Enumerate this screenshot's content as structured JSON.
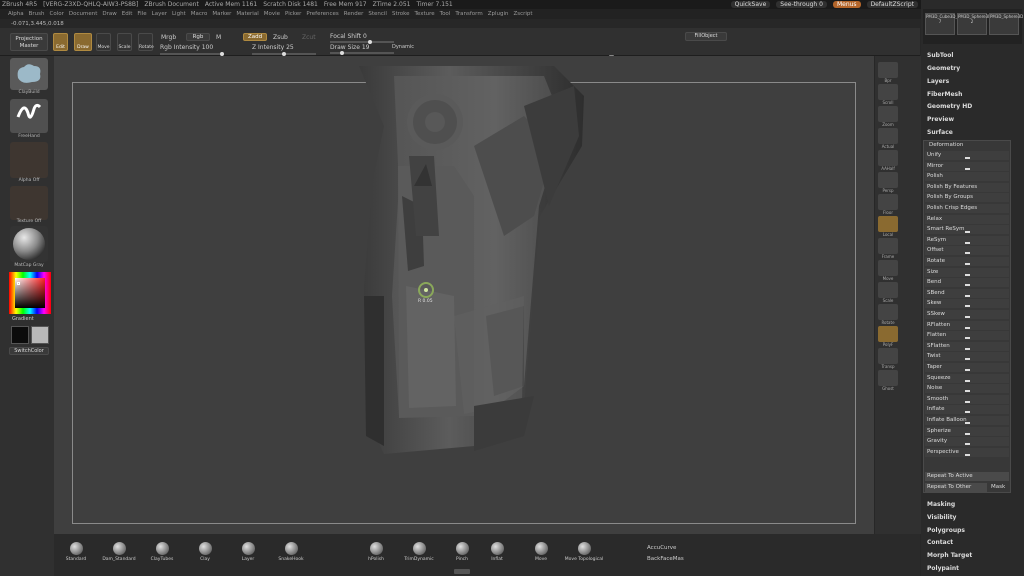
{
  "titlebar": {
    "app": "ZBrush 4R5",
    "build": "[VERG-Z3XD-QHLQ-AIW3-PS8B]",
    "doc": "ZBrush Document",
    "active_mem": "Active Mem 1161",
    "scratch": "Scratch Disk 1481",
    "free_mem": "Free Mem 917",
    "ztime": "ZTime 2.051",
    "timer": "Timer 7.151",
    "quicksave": "QuickSave",
    "seethrough": "See-through 0",
    "menus": "Menus",
    "script": "DefaultZScript"
  },
  "menubar": [
    "Alpha",
    "Brush",
    "Color",
    "Document",
    "Draw",
    "Edit",
    "File",
    "Layer",
    "Light",
    "Macro",
    "Marker",
    "Material",
    "Movie",
    "Picker",
    "Preferences",
    "Render",
    "Stencil",
    "Stroke",
    "Texture",
    "Tool",
    "Transform",
    "Zplugin",
    "Zscript"
  ],
  "coords": "-0.071,3.445,0.018",
  "topshelf": {
    "projection": "Projection",
    "master": "Master",
    "edit": "Edit",
    "draw": "Draw",
    "move": "Move",
    "scale": "Scale",
    "rotate": "Rotate",
    "mrgb": "Mrgb",
    "rgb": "Rgb",
    "m": "M",
    "zadd": "Zadd",
    "zsub": "Zsub",
    "zcut": "Zcut",
    "rgb_intensity_label": "Rgb Intensity",
    "rgb_intensity": "100",
    "z_intensity_label": "Z Intensity",
    "z_intensity": "25",
    "focal_shift_label": "Focal Shift",
    "focal_shift": "0",
    "draw_size_label": "Draw Size",
    "draw_size": "19",
    "dynamic": "Dynamic",
    "fillobject": "FillObject"
  },
  "leftshelf": {
    "brush_cap": "ClayBuild",
    "stroke_cap": "FreeHand",
    "alpha_cap": "Alpha Off",
    "texture_cap": "Texture Off",
    "material_cap": "MatCap Gray",
    "gradient": "Gradient",
    "switchcolor": "SwitchColor"
  },
  "cursor_label": "R 0.05",
  "rightshelf": [
    "Bpr",
    "Scroll",
    "Zoom",
    "Actual",
    "AAHalf",
    "Persp",
    "Floor",
    "Local",
    "Frame",
    "Move",
    "Scale",
    "Rotate",
    "PolyF",
    "Transp",
    "Ghost"
  ],
  "tray": {
    "thumbs": [
      "PM3D_Cube3D_1",
      "PM3D_Sphere3D",
      "PM3D_Sphere3D"
    ],
    "thumb_counts": [
      "7",
      "2",
      ""
    ],
    "menu": [
      "SubTool",
      "Geometry",
      "Layers",
      "FiberMesh",
      "Geometry HD",
      "Preview",
      "Surface"
    ],
    "deformation_title": "Deformation",
    "deform_items": [
      "Unify",
      "Mirror",
      "Polish",
      "Polish By Features",
      "Polish By Groups",
      "Polish Crisp Edges",
      "Relax",
      "Smart ReSym",
      "ReSym",
      "Offset",
      "Rotate",
      "Size",
      "Bend",
      "SBend",
      "Skew",
      "SSkew",
      "RFlatten",
      "Flatten",
      "SFlatten",
      "Twist",
      "Taper",
      "Squeeze",
      "Noise",
      "Smooth",
      "Inflate",
      "Inflate Balloon",
      "Spherize",
      "Gravity",
      "Perspective"
    ],
    "repeat_active": "Repeat To Active",
    "repeat_other": "Repeat To Other",
    "mask": "Mask",
    "bottom_menu": [
      "Masking",
      "Visibility",
      "Polygroups",
      "Contact",
      "Morph Target",
      "Polypaint"
    ]
  },
  "bottombar": {
    "brushes": [
      "Standard",
      "Dam_Standard",
      "ClayTubes",
      "Clay",
      "Layer",
      "SnakeHook",
      "hPolish",
      "TrimDynamic",
      "Pinch",
      "Inflat",
      "Move",
      "Move Topological"
    ],
    "accucurve": "AccuCurve",
    "backfacemask": "BackFaceMas"
  }
}
